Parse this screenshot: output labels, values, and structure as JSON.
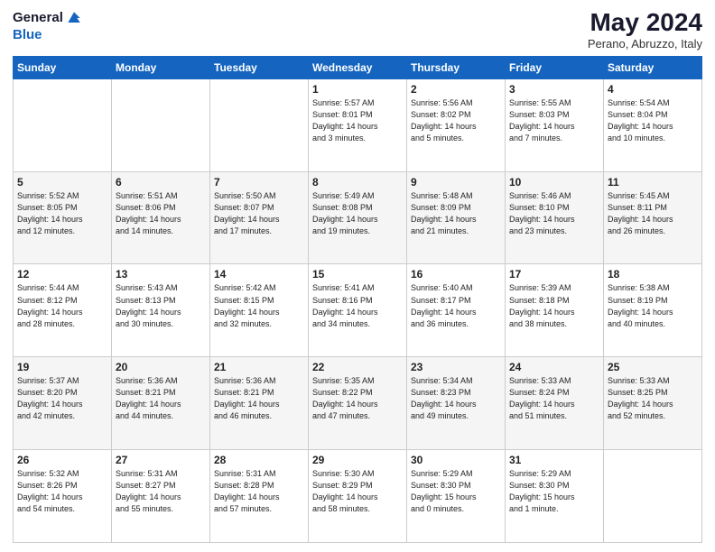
{
  "header": {
    "logo_line1": "General",
    "logo_line2": "Blue",
    "title": "May 2024",
    "subtitle": "Perano, Abruzzo, Italy"
  },
  "weekdays": [
    "Sunday",
    "Monday",
    "Tuesday",
    "Wednesday",
    "Thursday",
    "Friday",
    "Saturday"
  ],
  "weeks": [
    [
      {
        "day": "",
        "info": ""
      },
      {
        "day": "",
        "info": ""
      },
      {
        "day": "",
        "info": ""
      },
      {
        "day": "1",
        "info": "Sunrise: 5:57 AM\nSunset: 8:01 PM\nDaylight: 14 hours\nand 3 minutes."
      },
      {
        "day": "2",
        "info": "Sunrise: 5:56 AM\nSunset: 8:02 PM\nDaylight: 14 hours\nand 5 minutes."
      },
      {
        "day": "3",
        "info": "Sunrise: 5:55 AM\nSunset: 8:03 PM\nDaylight: 14 hours\nand 7 minutes."
      },
      {
        "day": "4",
        "info": "Sunrise: 5:54 AM\nSunset: 8:04 PM\nDaylight: 14 hours\nand 10 minutes."
      }
    ],
    [
      {
        "day": "5",
        "info": "Sunrise: 5:52 AM\nSunset: 8:05 PM\nDaylight: 14 hours\nand 12 minutes."
      },
      {
        "day": "6",
        "info": "Sunrise: 5:51 AM\nSunset: 8:06 PM\nDaylight: 14 hours\nand 14 minutes."
      },
      {
        "day": "7",
        "info": "Sunrise: 5:50 AM\nSunset: 8:07 PM\nDaylight: 14 hours\nand 17 minutes."
      },
      {
        "day": "8",
        "info": "Sunrise: 5:49 AM\nSunset: 8:08 PM\nDaylight: 14 hours\nand 19 minutes."
      },
      {
        "day": "9",
        "info": "Sunrise: 5:48 AM\nSunset: 8:09 PM\nDaylight: 14 hours\nand 21 minutes."
      },
      {
        "day": "10",
        "info": "Sunrise: 5:46 AM\nSunset: 8:10 PM\nDaylight: 14 hours\nand 23 minutes."
      },
      {
        "day": "11",
        "info": "Sunrise: 5:45 AM\nSunset: 8:11 PM\nDaylight: 14 hours\nand 26 minutes."
      }
    ],
    [
      {
        "day": "12",
        "info": "Sunrise: 5:44 AM\nSunset: 8:12 PM\nDaylight: 14 hours\nand 28 minutes."
      },
      {
        "day": "13",
        "info": "Sunrise: 5:43 AM\nSunset: 8:13 PM\nDaylight: 14 hours\nand 30 minutes."
      },
      {
        "day": "14",
        "info": "Sunrise: 5:42 AM\nSunset: 8:15 PM\nDaylight: 14 hours\nand 32 minutes."
      },
      {
        "day": "15",
        "info": "Sunrise: 5:41 AM\nSunset: 8:16 PM\nDaylight: 14 hours\nand 34 minutes."
      },
      {
        "day": "16",
        "info": "Sunrise: 5:40 AM\nSunset: 8:17 PM\nDaylight: 14 hours\nand 36 minutes."
      },
      {
        "day": "17",
        "info": "Sunrise: 5:39 AM\nSunset: 8:18 PM\nDaylight: 14 hours\nand 38 minutes."
      },
      {
        "day": "18",
        "info": "Sunrise: 5:38 AM\nSunset: 8:19 PM\nDaylight: 14 hours\nand 40 minutes."
      }
    ],
    [
      {
        "day": "19",
        "info": "Sunrise: 5:37 AM\nSunset: 8:20 PM\nDaylight: 14 hours\nand 42 minutes."
      },
      {
        "day": "20",
        "info": "Sunrise: 5:36 AM\nSunset: 8:21 PM\nDaylight: 14 hours\nand 44 minutes."
      },
      {
        "day": "21",
        "info": "Sunrise: 5:36 AM\nSunset: 8:21 PM\nDaylight: 14 hours\nand 46 minutes."
      },
      {
        "day": "22",
        "info": "Sunrise: 5:35 AM\nSunset: 8:22 PM\nDaylight: 14 hours\nand 47 minutes."
      },
      {
        "day": "23",
        "info": "Sunrise: 5:34 AM\nSunset: 8:23 PM\nDaylight: 14 hours\nand 49 minutes."
      },
      {
        "day": "24",
        "info": "Sunrise: 5:33 AM\nSunset: 8:24 PM\nDaylight: 14 hours\nand 51 minutes."
      },
      {
        "day": "25",
        "info": "Sunrise: 5:33 AM\nSunset: 8:25 PM\nDaylight: 14 hours\nand 52 minutes."
      }
    ],
    [
      {
        "day": "26",
        "info": "Sunrise: 5:32 AM\nSunset: 8:26 PM\nDaylight: 14 hours\nand 54 minutes."
      },
      {
        "day": "27",
        "info": "Sunrise: 5:31 AM\nSunset: 8:27 PM\nDaylight: 14 hours\nand 55 minutes."
      },
      {
        "day": "28",
        "info": "Sunrise: 5:31 AM\nSunset: 8:28 PM\nDaylight: 14 hours\nand 57 minutes."
      },
      {
        "day": "29",
        "info": "Sunrise: 5:30 AM\nSunset: 8:29 PM\nDaylight: 14 hours\nand 58 minutes."
      },
      {
        "day": "30",
        "info": "Sunrise: 5:29 AM\nSunset: 8:30 PM\nDaylight: 15 hours\nand 0 minutes."
      },
      {
        "day": "31",
        "info": "Sunrise: 5:29 AM\nSunset: 8:30 PM\nDaylight: 15 hours\nand 1 minute."
      },
      {
        "day": "",
        "info": ""
      }
    ]
  ]
}
